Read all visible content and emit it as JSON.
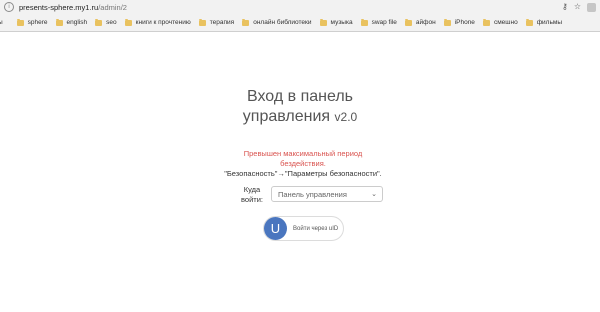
{
  "browser": {
    "url_host": "presents-sphere.my1.ru",
    "url_path": "/admin/2",
    "bookmarks": [
      {
        "label": "ы"
      },
      {
        "label": "sphere"
      },
      {
        "label": "english"
      },
      {
        "label": "seo"
      },
      {
        "label": "книги к прочтению"
      },
      {
        "label": "терапия"
      },
      {
        "label": "онлайн библиотеки"
      },
      {
        "label": "музыка"
      },
      {
        "label": "swap file"
      },
      {
        "label": "айфон"
      },
      {
        "label": "iPhone"
      },
      {
        "label": "смешно"
      },
      {
        "label": "фильмы"
      }
    ]
  },
  "login": {
    "title_line1": "Вход в панель",
    "title_line2": "управления",
    "version": "v2.0",
    "error_line1": "Превышен максимальный период",
    "error_line2": "бездействия.",
    "hint": "\"Безопасность\"→\"Параметры безопасности\".",
    "where_label_1": "Куда",
    "where_label_2": "войти:",
    "where_selected": "Панель управления",
    "uid_letter": "U",
    "uid_button_label": "Войти через uID"
  },
  "colors": {
    "error": "#d9534f",
    "uid_brand": "#4a76bf",
    "bookmark_folder": "#e9c25f"
  }
}
